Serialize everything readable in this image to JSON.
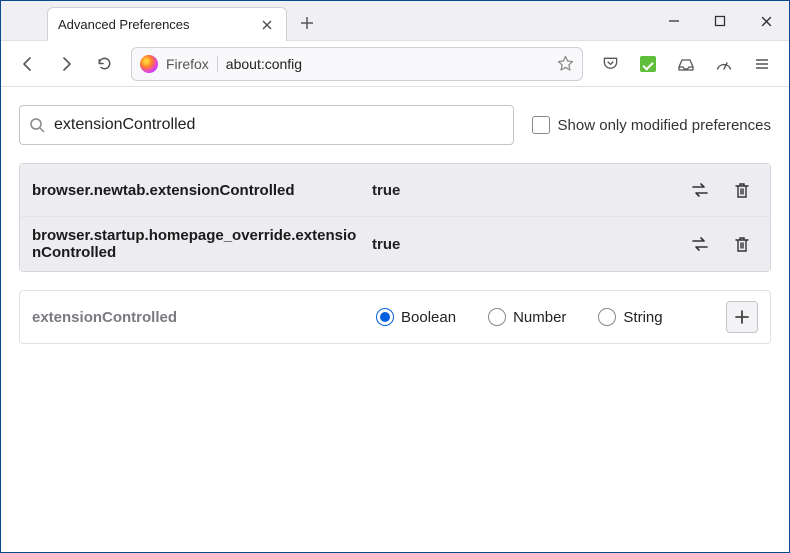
{
  "tab": {
    "title": "Advanced Preferences"
  },
  "urlbar": {
    "identity": "Firefox",
    "url": "about:config"
  },
  "search": {
    "value": "extensionControlled",
    "show_modified_label": "Show only modified preferences"
  },
  "prefs": [
    {
      "name": "browser.newtab.extensionControlled",
      "value": "true"
    },
    {
      "name": "browser.startup.homepage_override.extensionControlled",
      "value": "true"
    }
  ],
  "new_pref": {
    "name": "extensionControlled"
  },
  "types": {
    "boolean": "Boolean",
    "number": "Number",
    "string": "String"
  }
}
